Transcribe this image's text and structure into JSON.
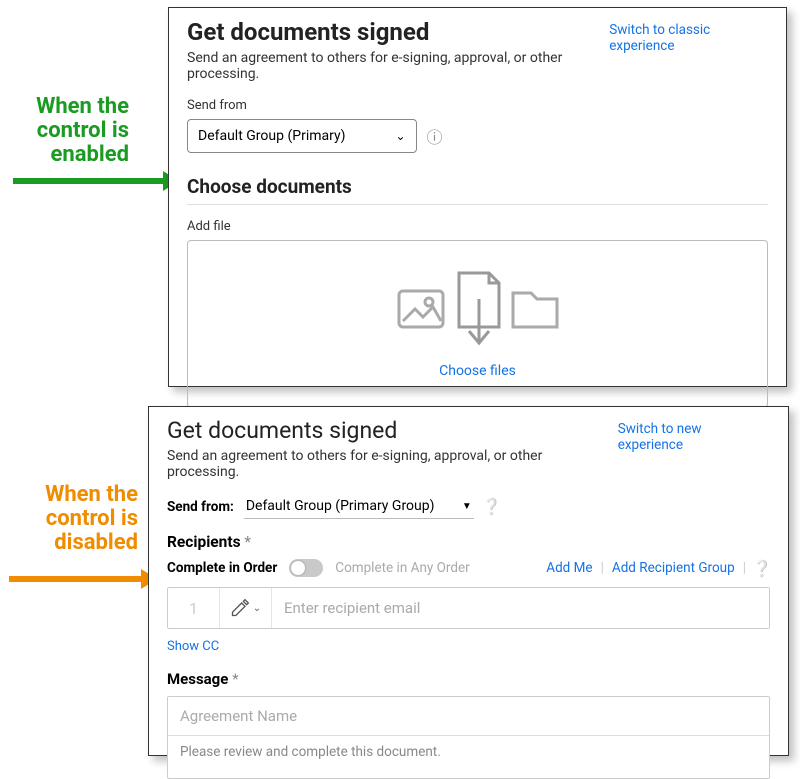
{
  "annotations": {
    "enabled": "When the control is enabled",
    "disabled": "When the control is disabled"
  },
  "panel1": {
    "title": "Get documents signed",
    "subtitle": "Send an agreement to others for e-signing, approval, or other processing.",
    "switch_link": "Switch to classic experience",
    "send_from_label": "Send from",
    "send_from_value": "Default Group (Primary)",
    "choose_documents": "Choose documents",
    "add_file_label": "Add file",
    "choose_files": "Choose files"
  },
  "panel2": {
    "title": "Get documents signed",
    "subtitle": "Send an agreement to others for e-signing, approval, or other processing.",
    "switch_link": "Switch to new experience",
    "send_from_label": "Send from:",
    "send_from_value": "Default Group (Primary Group)",
    "recipients_label": "Recipients",
    "complete_in_order": "Complete in Order",
    "complete_any_order": "Complete in Any Order",
    "add_me": "Add Me",
    "add_group": "Add Recipient Group",
    "recipient_num": "1",
    "recipient_placeholder": "Enter recipient email",
    "show_cc": "Show CC",
    "message_label": "Message",
    "agreement_placeholder": "Agreement Name",
    "message_text": "Please review and complete this document."
  }
}
